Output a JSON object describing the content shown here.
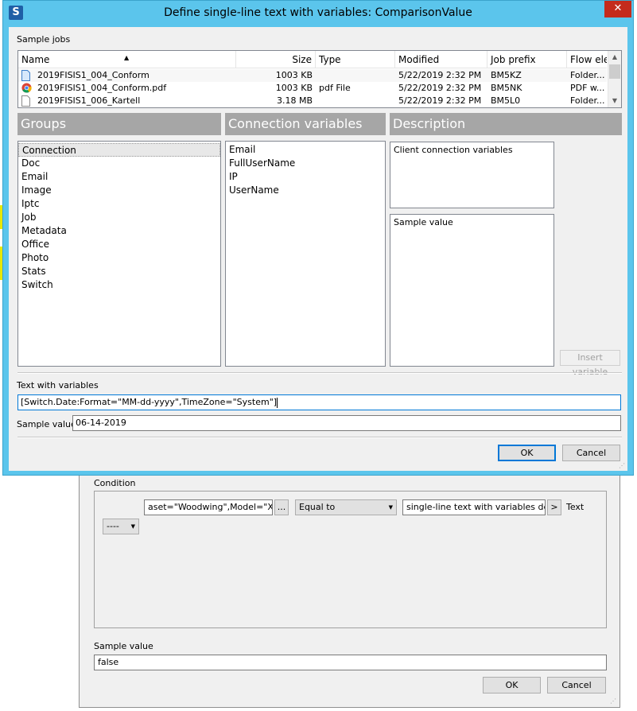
{
  "background_dialog": {
    "condition_label": "Condition",
    "left_field_value": "aset=\"Woodwing\",Model=\"XML\"]",
    "ellipsis_label": "...",
    "operator_value": "Equal to",
    "right_field_value": "single-line text with variables defined",
    "arrow_label": ">",
    "type_label": "Text",
    "small_combo_value": "----",
    "sample_value_label": "Sample value",
    "sample_value": "false",
    "ok_label": "OK",
    "cancel_label": "Cancel"
  },
  "main_dialog": {
    "app_logo": "S",
    "title": "Define single-line text with variables: ComparisonValue",
    "close_icon": "close-icon",
    "close_glyph": "✕",
    "sample_jobs_label": "Sample jobs",
    "file_list": {
      "columns": [
        "Name",
        "Size",
        "Type",
        "Modified",
        "Job prefix",
        "Flow ele"
      ],
      "rows": [
        {
          "name": "2019FISIS1_004_Conform",
          "size": "1003 KB",
          "type": "",
          "modified": "5/22/2019 2:32 PM",
          "prefix": "BM5KZ",
          "flow": "Folder...",
          "icon": "folder-doc-icon"
        },
        {
          "name": "2019FISIS1_004_Conform.pdf",
          "size": "1003 KB",
          "type": "pdf File",
          "modified": "5/22/2019 2:32 PM",
          "prefix": "BM5NK",
          "flow": "PDF w...",
          "icon": "chrome-icon"
        },
        {
          "name": "2019FISIS1_006_Kartell",
          "size": "3.18 MB",
          "type": "",
          "modified": "5/22/2019 2:32 PM",
          "prefix": "BM5L0",
          "flow": "Folder...",
          "icon": "blank-doc-icon"
        }
      ]
    },
    "groups_header": "Groups",
    "connection_vars_header": "Connection variables",
    "description_header": "Description",
    "groups": [
      "Connection",
      "Doc",
      "Email",
      "Image",
      "Iptc",
      "Job",
      "Metadata",
      "Office",
      "Photo",
      "Stats",
      "Switch"
    ],
    "selected_group": "Connection",
    "variables": [
      "Email",
      "FullUserName",
      "IP",
      "UserName"
    ],
    "description_text": "Client connection variables",
    "sample_value_box_label": "Sample value",
    "insert_variable_label": "Insert variable",
    "text_with_variables_label": "Text with variables",
    "text_with_variables_value": "[Switch.Date:Format=\"MM-dd-yyyy\",TimeZone=\"System\"]",
    "sample_value_label": "Sample value",
    "sample_value": "06-14-2019",
    "ok_label": "OK",
    "cancel_label": "Cancel"
  },
  "colors": {
    "title_bar": "#5bc5ec",
    "panel_header": "#a6a6a6",
    "close_button": "#c42b1c",
    "focus_border": "#0078d7"
  }
}
